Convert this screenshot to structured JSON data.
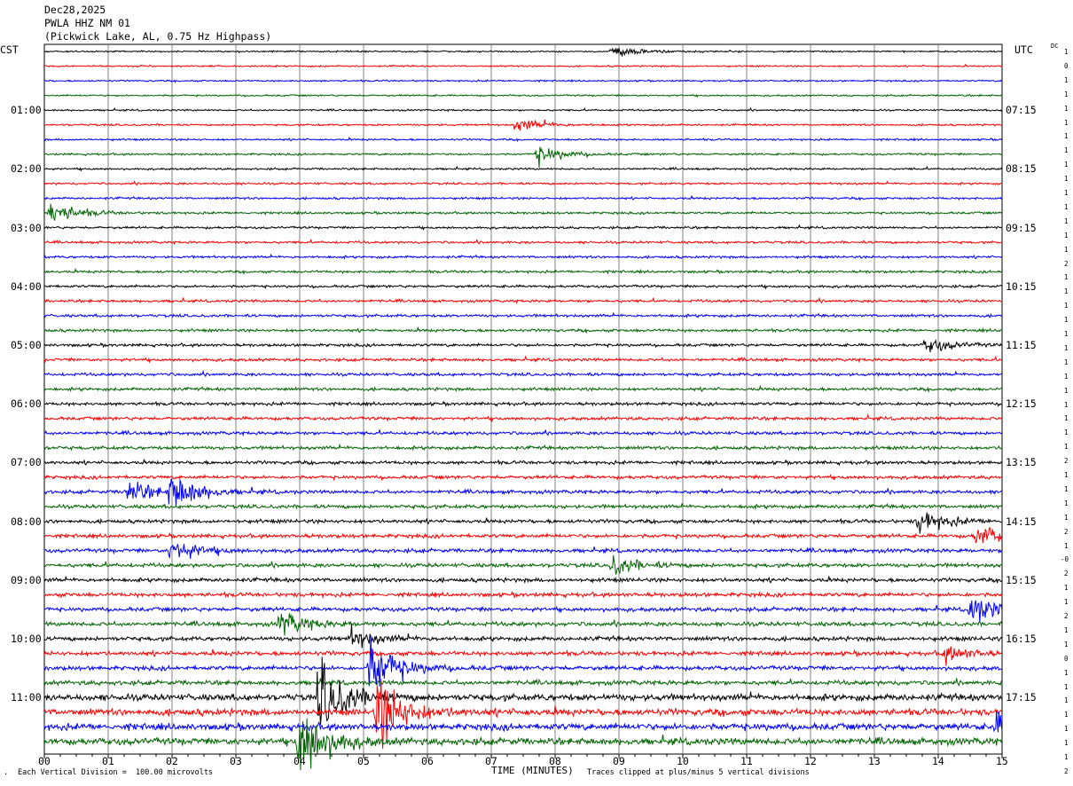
{
  "header": {
    "date": "Dec28,2025",
    "station": "PWLA HHZ NM 01",
    "location": "(Pickwick Lake, AL, 0.75 Hz Highpass)"
  },
  "left_tz": "CST",
  "right_tz": "UTC",
  "dc_label": "DC",
  "footer": {
    "scale": "Each Vertical Division =  100.00 microvolts",
    "xlabel": "TIME (MINUTES)",
    "clip_note": "Traces clipped at plus/minus 5 vertical divisions"
  },
  "colors": {
    "trace_cycle": [
      "#000000",
      "#ff0000",
      "#0000ff",
      "#006400"
    ],
    "grid": "#808080"
  },
  "chart_data": {
    "type": "line",
    "title": "PWLA HHZ NM 01",
    "xlabel": "TIME (MINUTES)",
    "x_ticks": [
      "00",
      "01",
      "02",
      "03",
      "04",
      "05",
      "06",
      "07",
      "08",
      "09",
      "10",
      "11",
      "12",
      "13",
      "14",
      "15"
    ],
    "xlim": [
      0,
      15
    ],
    "left_time_labels": [
      "01:00",
      "02:00",
      "03:00",
      "04:00",
      "05:00",
      "06:00",
      "07:00",
      "08:00",
      "09:00",
      "10:00",
      "11:00"
    ],
    "right_time_labels": [
      "07:15",
      "08:15",
      "09:15",
      "10:15",
      "11:15",
      "12:15",
      "13:15",
      "14:15",
      "15:15",
      "16:15",
      "17:15"
    ],
    "trace_count": 48,
    "dc_offsets": [
      "1",
      "0",
      "1",
      "1",
      "1",
      "1",
      "1",
      "1",
      "1",
      "1",
      "1",
      "1",
      "1",
      "1",
      "1",
      "2",
      "1",
      "1",
      "1",
      "1",
      "1",
      "1",
      "1",
      "1",
      "1",
      "1",
      "1",
      "1",
      "1",
      "2",
      "1",
      "1",
      "1",
      "1",
      "2",
      "1",
      "-0",
      "2",
      "1",
      "1",
      "2",
      "1",
      "1",
      "0",
      "1",
      "1",
      "1",
      "1",
      "1",
      "1",
      "1",
      "2"
    ],
    "events": [
      {
        "trace": 0,
        "minute": 8.9,
        "amplitude": 0.8
      },
      {
        "trace": 5,
        "minute": 7.4,
        "amplitude": 0.8
      },
      {
        "trace": 7,
        "minute": 7.7,
        "amplitude": 1.2
      },
      {
        "trace": 11,
        "minute": 0.1,
        "amplitude": 1.5
      },
      {
        "trace": 20,
        "minute": 13.8,
        "amplitude": 1.0
      },
      {
        "trace": 30,
        "minute": 2.0,
        "amplitude": 2.5
      },
      {
        "trace": 30,
        "minute": 1.3,
        "amplitude": 1.5
      },
      {
        "trace": 32,
        "minute": 13.7,
        "amplitude": 1.5
      },
      {
        "trace": 33,
        "minute": 14.6,
        "amplitude": 1.5
      },
      {
        "trace": 34,
        "minute": 2.0,
        "amplitude": 1.5
      },
      {
        "trace": 35,
        "minute": 8.9,
        "amplitude": 1.2
      },
      {
        "trace": 38,
        "minute": 14.5,
        "amplitude": 2.0
      },
      {
        "trace": 39,
        "minute": 3.7,
        "amplitude": 1.5
      },
      {
        "trace": 40,
        "minute": 4.8,
        "amplitude": 1.2
      },
      {
        "trace": 41,
        "minute": 14.1,
        "amplitude": 1.0
      },
      {
        "trace": 42,
        "minute": 5.1,
        "amplitude": 4.0
      },
      {
        "trace": 45,
        "minute": 5.2,
        "amplitude": 5.0
      },
      {
        "trace": 44,
        "minute": 4.3,
        "amplitude": 5.0
      },
      {
        "trace": 46,
        "minute": 14.9,
        "amplitude": 1.5
      },
      {
        "trace": 47,
        "minute": 4.0,
        "amplitude": 5.0
      }
    ]
  }
}
